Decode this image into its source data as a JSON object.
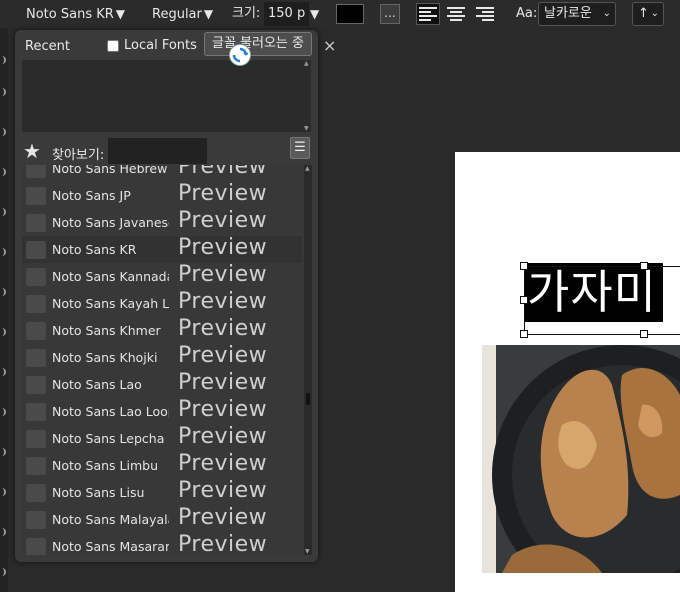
{
  "toolbar": {
    "font_family": "Noto Sans KR",
    "font_style": "Regular",
    "size_label": "크기:",
    "size_value": "150 p",
    "more_label": "...",
    "aa_label": "Aa:",
    "antialias_value": "날카로운",
    "direction_value": "↑",
    "caret": "▼",
    "swatch_color": "#000000"
  },
  "font_panel": {
    "recent_label": "Recent",
    "local_fonts_label": "Local Fonts",
    "load_button_label": "글꼴 불러오는 중",
    "close_label": "×",
    "search_label": "찾아보기:",
    "search_value": "",
    "menu_label": "☰",
    "fonts": [
      {
        "name": "Noto Sans Hebrew",
        "preview": "Preview"
      },
      {
        "name": "Noto Sans JP",
        "preview": "Preview"
      },
      {
        "name": "Noto Sans Javanese",
        "preview": "Preview"
      },
      {
        "name": "Noto Sans KR",
        "preview": "Preview",
        "selected": true
      },
      {
        "name": "Noto Sans Kannada",
        "preview": "Preview"
      },
      {
        "name": "Noto Sans Kayah Li",
        "preview": "Preview"
      },
      {
        "name": "Noto Sans Khmer",
        "preview": "Preview"
      },
      {
        "name": "Noto Sans Khojki",
        "preview": "Preview"
      },
      {
        "name": "Noto Sans Lao",
        "preview": "Preview"
      },
      {
        "name": "Noto Sans Lao Looped",
        "preview": "Preview"
      },
      {
        "name": "Noto Sans Lepcha",
        "preview": "Preview"
      },
      {
        "name": "Noto Sans Limbu",
        "preview": "Preview"
      },
      {
        "name": "Noto Sans Lisu",
        "preview": "Preview"
      },
      {
        "name": "Noto Sans Malayalam",
        "preview": "Preview"
      },
      {
        "name": "Noto Sans Masaram Gondi",
        "preview": "Preview"
      }
    ]
  },
  "canvas": {
    "text_layer": "가자미"
  }
}
